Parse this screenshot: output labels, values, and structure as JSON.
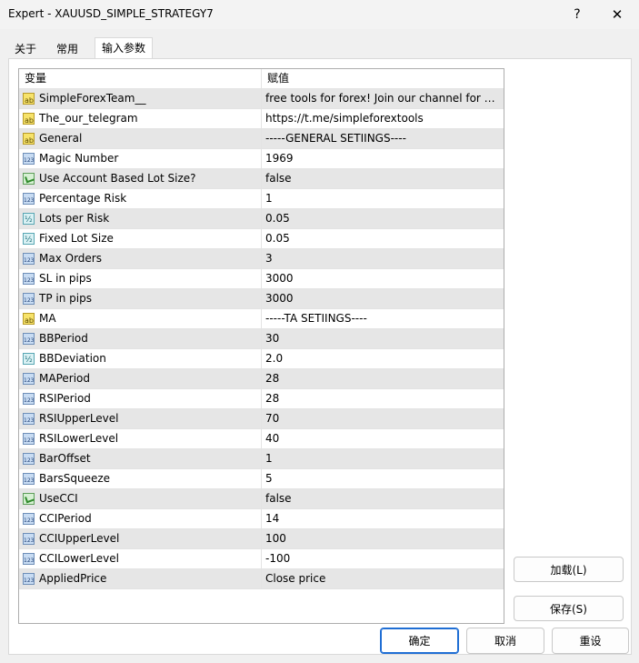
{
  "window": {
    "title": "Expert - XAUUSD_SIMPLE_STRATEGY7",
    "help_label": "?",
    "close_label": "✕"
  },
  "tabs": [
    {
      "label": "关于"
    },
    {
      "label": "常用"
    },
    {
      "label": "输入参数"
    }
  ],
  "grid": {
    "headers": {
      "variable": "变量",
      "value": "赋值"
    },
    "rows": [
      {
        "icon": "string-icon",
        "name": "SimpleForexTeam__",
        "value": "free tools for forex! Join our channel for more"
      },
      {
        "icon": "string-icon",
        "name": "The_our_telegram",
        "value": "https://t.me/simpleforextools"
      },
      {
        "icon": "string-icon",
        "name": "General",
        "value": "-----GENERAL SETIINGS----"
      },
      {
        "icon": "integer-icon",
        "name": "Magic Number",
        "value": "1969"
      },
      {
        "icon": "bool-icon",
        "name": "Use Account Based Lot Size?",
        "value": "false"
      },
      {
        "icon": "integer-icon",
        "name": "Percentage Risk",
        "value": "1"
      },
      {
        "icon": "double-icon",
        "name": "Lots per Risk",
        "value": "0.05"
      },
      {
        "icon": "double-icon",
        "name": "Fixed Lot Size",
        "value": "0.05"
      },
      {
        "icon": "integer-icon",
        "name": "Max Orders",
        "value": "3"
      },
      {
        "icon": "integer-icon",
        "name": "SL in pips",
        "value": "3000"
      },
      {
        "icon": "integer-icon",
        "name": "TP in pips",
        "value": "3000"
      },
      {
        "icon": "string-icon",
        "name": "MA",
        "value": "-----TA SETIINGS----"
      },
      {
        "icon": "integer-icon",
        "name": "BBPeriod",
        "value": "30"
      },
      {
        "icon": "double-icon",
        "name": "BBDeviation",
        "value": "2.0"
      },
      {
        "icon": "integer-icon",
        "name": "MAPeriod",
        "value": "28"
      },
      {
        "icon": "integer-icon",
        "name": "RSIPeriod",
        "value": "28"
      },
      {
        "icon": "integer-icon",
        "name": "RSIUpperLevel",
        "value": "70"
      },
      {
        "icon": "integer-icon",
        "name": "RSILowerLevel",
        "value": "40"
      },
      {
        "icon": "integer-icon",
        "name": "BarOffset",
        "value": "1"
      },
      {
        "icon": "integer-icon",
        "name": "BarsSqueeze",
        "value": "5"
      },
      {
        "icon": "bool-icon",
        "name": "UseCCI",
        "value": "false"
      },
      {
        "icon": "integer-icon",
        "name": "CCIPeriod",
        "value": "14"
      },
      {
        "icon": "integer-icon",
        "name": "CCIUpperLevel",
        "value": "100"
      },
      {
        "icon": "integer-icon",
        "name": "CCILowerLevel",
        "value": "-100"
      },
      {
        "icon": "integer-icon",
        "name": "AppliedPrice",
        "value": "Close price"
      }
    ]
  },
  "buttons": {
    "load": "加载(L)",
    "save": "保存(S)",
    "ok": "确定",
    "cancel": "取消",
    "reset": "重设"
  },
  "colors": {
    "accent": "#1f6ed4",
    "row_alt": "#e6e6e6"
  }
}
